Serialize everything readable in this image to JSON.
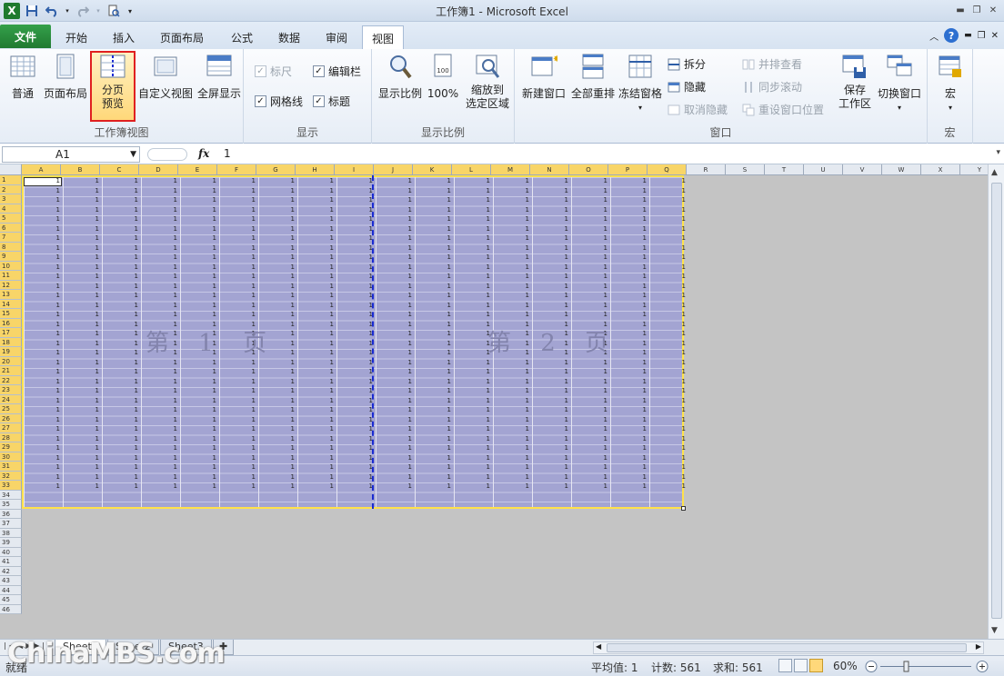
{
  "window": {
    "title": "工作簿1 - Microsoft Excel",
    "app_badge": "X"
  },
  "tabs": {
    "file": "文件",
    "items": [
      "开始",
      "插入",
      "页面布局",
      "公式",
      "数据",
      "审阅",
      "视图"
    ],
    "active": "视图"
  },
  "ribbon": {
    "workbook_views": {
      "label": "工作簿视图",
      "normal": "普通",
      "page_layout": "页面布局",
      "page_break_preview_line1": "分页",
      "page_break_preview_line2": "预览",
      "custom_views": "自定义视图",
      "full_screen": "全屏显示"
    },
    "show": {
      "label": "显示",
      "ruler": "标尺",
      "formula_bar": "编辑栏",
      "gridlines": "网格线",
      "headings": "标题"
    },
    "zoom": {
      "label": "显示比例",
      "zoom": "显示比例",
      "hundred": "100%",
      "zoom_to_selection_line1": "缩放到",
      "zoom_to_selection_line2": "选定区域"
    },
    "window": {
      "label": "窗口",
      "new_window": "新建窗口",
      "arrange_all": "全部重排",
      "freeze_panes": "冻结窗格",
      "split": "拆分",
      "hide": "隐藏",
      "unhide": "取消隐藏",
      "side_by_side": "并排查看",
      "sync_scroll": "同步滚动",
      "reset_position": "重设窗口位置",
      "save_workspace_line1": "保存",
      "save_workspace_line2": "工作区",
      "switch_windows": "切换窗口"
    },
    "macros": {
      "label": "宏",
      "macros": "宏"
    }
  },
  "formula_bar": {
    "name_box": "A1",
    "fx": "fx",
    "value": "1"
  },
  "sheet": {
    "columns": [
      "A",
      "B",
      "C",
      "D",
      "E",
      "F",
      "G",
      "H",
      "I",
      "J",
      "K",
      "L",
      "M",
      "N",
      "O",
      "P",
      "Q",
      "R",
      "S",
      "T",
      "U",
      "V",
      "W",
      "X",
      "Y"
    ],
    "rows": [
      "1",
      "2",
      "3",
      "4",
      "5",
      "6",
      "7",
      "8",
      "9",
      "10",
      "11",
      "12",
      "13",
      "14",
      "15",
      "16",
      "17",
      "18",
      "19",
      "20",
      "21",
      "22",
      "23",
      "24",
      "25",
      "26",
      "27",
      "28",
      "29",
      "30",
      "31",
      "32",
      "33",
      "34",
      "35",
      "36",
      "37",
      "38",
      "39",
      "40",
      "41",
      "42",
      "43",
      "44",
      "45",
      "46"
    ],
    "filled_rows": 33,
    "filled_cols": 17,
    "cell_value": "1",
    "page_labels": [
      "第 1 页",
      "第 2 页"
    ]
  },
  "sheet_tabs": [
    "Sheet1",
    "Sheet2",
    "Sheet3"
  ],
  "status": {
    "mode": "就绪",
    "average": "平均值: 1",
    "count": "计数: 561",
    "sum": "求和: 561",
    "zoom": "60%"
  },
  "watermark": "ChinaMBS.com",
  "colors": {
    "accent_green": "#207a31",
    "print_area_fill": "#a3a4d2",
    "page_break": "#1a2bd1",
    "print_border": "#ffe14a",
    "highlight_box": "#e02020"
  }
}
